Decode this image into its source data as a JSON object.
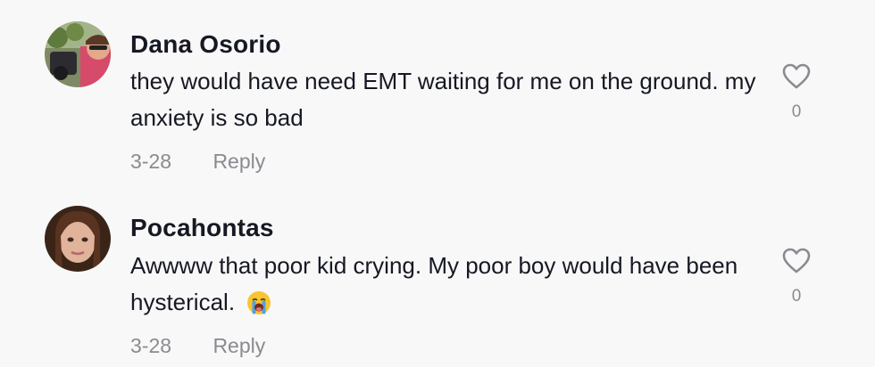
{
  "comments": [
    {
      "username": "Dana Osorio",
      "text": "they would have need EMT waiting for me on the ground. my anxiety is so bad",
      "date": "3-28",
      "reply_label": "Reply",
      "likes": "0",
      "avatar_icon": "user-photo-avatar"
    },
    {
      "username": "Pocahontas",
      "text": "Awwww that poor kid crying. My poor boy would have been hysterical.",
      "emoji": "loudly-crying-face",
      "date": "3-28",
      "reply_label": "Reply",
      "likes": "0",
      "avatar_icon": "user-photo-avatar"
    }
  ],
  "colors": {
    "background": "#f8f8f8",
    "text": "#161823",
    "secondary": "#8a8b91"
  }
}
